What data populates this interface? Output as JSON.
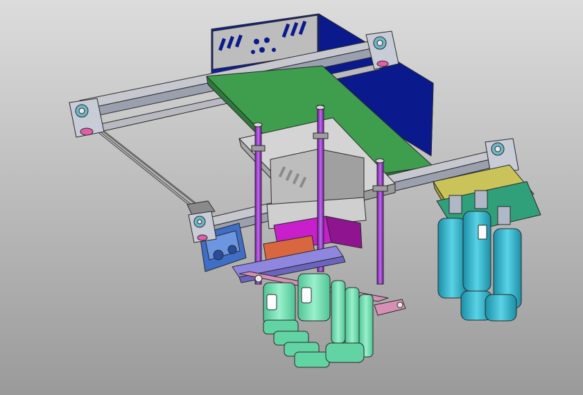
{
  "viewport": {
    "background_top": "#dcdcdc",
    "background_bottom": "#9a9a9a",
    "edge_color": "#3a3a3a"
  },
  "palette": {
    "motor_box": "#0a1a8c",
    "motor_box_side": "#061266",
    "faceplate": "#bdbdbd",
    "rail": "#b9b9c2",
    "green_plate": "#3f9d4e",
    "gray_block": "#c6c6c6",
    "guide_rod": "#9b2fc7",
    "magenta_block": "#c81ecb",
    "lavender_frame": "#8f86e0",
    "pink_frame": "#d68fb5",
    "orange_part": "#d8663f",
    "mint_bottles": "#6fe0b0",
    "teal_cylinders": "#2ab3c9",
    "olive_plate": "#c9c35a",
    "pcb_green": "#2fa07a",
    "lead_screw": "#6a6a6a",
    "blue_motor": "#3f6ec7",
    "bracket": "#c8ccd6",
    "bearing": "#6fb7c8"
  },
  "components": [
    {
      "name": "stepper-motor-box",
      "color": "motor_box"
    },
    {
      "name": "x-rail",
      "color": "rail"
    },
    {
      "name": "y-rail",
      "color": "rail"
    },
    {
      "name": "mounting-plate",
      "color": "green_plate"
    },
    {
      "name": "guide-rods",
      "color": "guide_rod"
    },
    {
      "name": "gripper-bottles",
      "color": "mint_bottles"
    },
    {
      "name": "cylinder-gripper",
      "color": "teal_cylinders"
    },
    {
      "name": "lead-screw",
      "color": "lead_screw"
    },
    {
      "name": "drive-motor",
      "color": "blue_motor"
    }
  ]
}
